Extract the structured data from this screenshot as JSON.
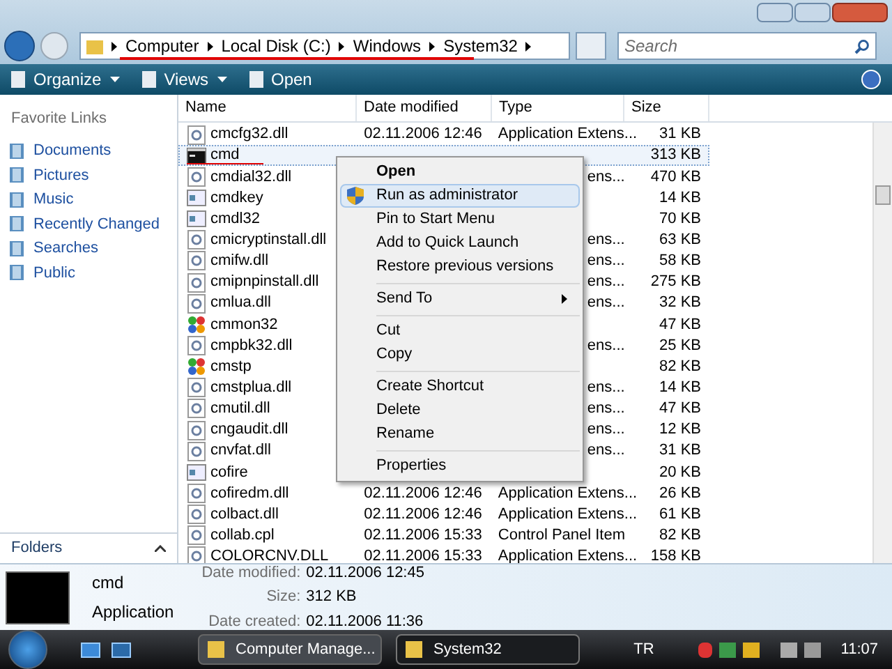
{
  "address_bar": {
    "crumbs": [
      "Computer",
      "Local Disk (C:)",
      "Windows",
      "System32"
    ]
  },
  "search": {
    "placeholder": "Search"
  },
  "toolbar": {
    "buttons": [
      {
        "label": "Organize",
        "kind": "dropdown"
      },
      {
        "label": "Views",
        "kind": "dropdown"
      },
      {
        "label": "Open",
        "kind": "plain"
      }
    ]
  },
  "sidebar": {
    "title": "Favorite Links",
    "items": [
      {
        "label": "Documents"
      },
      {
        "label": "Pictures"
      },
      {
        "label": "Music"
      },
      {
        "label": "Recently Changed"
      },
      {
        "label": "Searches"
      },
      {
        "label": "Public"
      }
    ],
    "folders": "Folders"
  },
  "table": {
    "columns": [
      "Name",
      "Date modified",
      "Type",
      "Size"
    ],
    "rows": [
      {
        "kind": "dll",
        "name": "cmcfg32.dll",
        "date": "02.11.2006 12:46",
        "type": "Application Extens...",
        "size": "31 KB",
        "selected": false
      },
      {
        "kind": "cmd",
        "name": "cmd",
        "size": "313 KB",
        "selected": true
      },
      {
        "kind": "dll",
        "name": "cmdial32.dll",
        "type_tail": "ens...",
        "size": "470 KB",
        "selected": false
      },
      {
        "kind": "app",
        "name": "cmdkey",
        "size": "14 KB",
        "selected": false
      },
      {
        "kind": "app",
        "name": "cmdl32",
        "size": "70 KB",
        "selected": false
      },
      {
        "kind": "dll",
        "name": "cmicryptinstall.dll",
        "type_tail": "ens...",
        "size": "63 KB",
        "selected": false
      },
      {
        "kind": "dll",
        "name": "cmifw.dll",
        "type_tail": "ens...",
        "size": "58 KB",
        "selected": false
      },
      {
        "kind": "dll",
        "name": "cmipnpinstall.dll",
        "type_tail": "ens...",
        "size": "275 KB",
        "selected": false
      },
      {
        "kind": "dll",
        "name": "cmlua.dll",
        "type_tail": "ens...",
        "size": "32 KB",
        "selected": false
      },
      {
        "kind": "tool",
        "name": "cmmon32",
        "size": "47 KB",
        "selected": false
      },
      {
        "kind": "dll",
        "name": "cmpbk32.dll",
        "type_tail": "ens...",
        "size": "25 KB",
        "selected": false
      },
      {
        "kind": "tool",
        "name": "cmstp",
        "size": "82 KB",
        "selected": false
      },
      {
        "kind": "dll",
        "name": "cmstplua.dll",
        "type_tail": "ens...",
        "size": "14 KB",
        "selected": false
      },
      {
        "kind": "dll",
        "name": "cmutil.dll",
        "type_tail": "ens...",
        "size": "47 KB",
        "selected": false
      },
      {
        "kind": "dll",
        "name": "cngaudit.dll",
        "type_tail": "ens...",
        "size": "12 KB",
        "selected": false
      },
      {
        "kind": "dll",
        "name": "cnvfat.dll",
        "type_tail": "ens...",
        "size": "31 KB",
        "selected": false
      },
      {
        "kind": "app",
        "name": "cofire",
        "size": "20 KB",
        "selected": false
      },
      {
        "kind": "dll",
        "name": "cofiredm.dll",
        "date": "02.11.2006 12:46",
        "type": "Application Extens...",
        "size": "26 KB",
        "selected": false
      },
      {
        "kind": "dll",
        "name": "colbact.dll",
        "date": "02.11.2006 12:46",
        "type": "Application Extens...",
        "size": "61 KB",
        "selected": false
      },
      {
        "kind": "dll",
        "name": "collab.cpl",
        "date": "02.11.2006 15:33",
        "type": "Control Panel Item",
        "size": "82 KB",
        "selected": false
      },
      {
        "kind": "dll",
        "name": "COLORCNV.DLL",
        "date": "02.11.2006 15:33",
        "type": "Application Extens...",
        "size": "158 KB",
        "selected": false
      }
    ]
  },
  "context_menu": {
    "items": [
      {
        "kind": "item",
        "label": "Open",
        "bold": true,
        "shield": false,
        "submenu": false,
        "selected": false
      },
      {
        "kind": "item",
        "label": "Run as administrator",
        "bold": false,
        "shield": true,
        "submenu": false,
        "selected": true
      },
      {
        "kind": "item",
        "label": "Pin to Start Menu",
        "bold": false,
        "shield": false,
        "submenu": false,
        "selected": false
      },
      {
        "kind": "item",
        "label": "Add to Quick Launch",
        "bold": false,
        "shield": false,
        "submenu": false,
        "selected": false
      },
      {
        "kind": "item",
        "label": "Restore previous versions",
        "bold": false,
        "shield": false,
        "submenu": false,
        "selected": false
      },
      {
        "kind": "separator"
      },
      {
        "kind": "item",
        "label": "Send To",
        "bold": false,
        "shield": false,
        "submenu": true,
        "selected": false
      },
      {
        "kind": "separator"
      },
      {
        "kind": "item",
        "label": "Cut",
        "bold": false,
        "shield": false,
        "submenu": false,
        "selected": false
      },
      {
        "kind": "item",
        "label": "Copy",
        "bold": false,
        "shield": false,
        "submenu": false,
        "selected": false
      },
      {
        "kind": "separator"
      },
      {
        "kind": "item",
        "label": "Create Shortcut",
        "bold": false,
        "shield": false,
        "submenu": false,
        "selected": false
      },
      {
        "kind": "item",
        "label": "Delete",
        "bold": false,
        "shield": false,
        "submenu": false,
        "selected": false
      },
      {
        "kind": "item",
        "label": "Rename",
        "bold": false,
        "shield": false,
        "submenu": false,
        "selected": false
      },
      {
        "kind": "separator"
      },
      {
        "kind": "item",
        "label": "Properties",
        "bold": false,
        "shield": false,
        "submenu": false,
        "selected": false
      }
    ]
  },
  "details_pane": {
    "name": "cmd",
    "type": "Application",
    "fields": [
      {
        "label": "Date modified:",
        "value": "02.11.2006 12:45"
      },
      {
        "label": "Size:",
        "value": "312 KB"
      },
      {
        "label": "Date created:",
        "value": "02.11.2006 11:36"
      }
    ]
  },
  "taskbar": {
    "tasks": [
      {
        "label": "Computer Manage...",
        "selected": false
      },
      {
        "label": "System32",
        "selected": true
      }
    ],
    "language": "TR",
    "clock": "11:07"
  }
}
